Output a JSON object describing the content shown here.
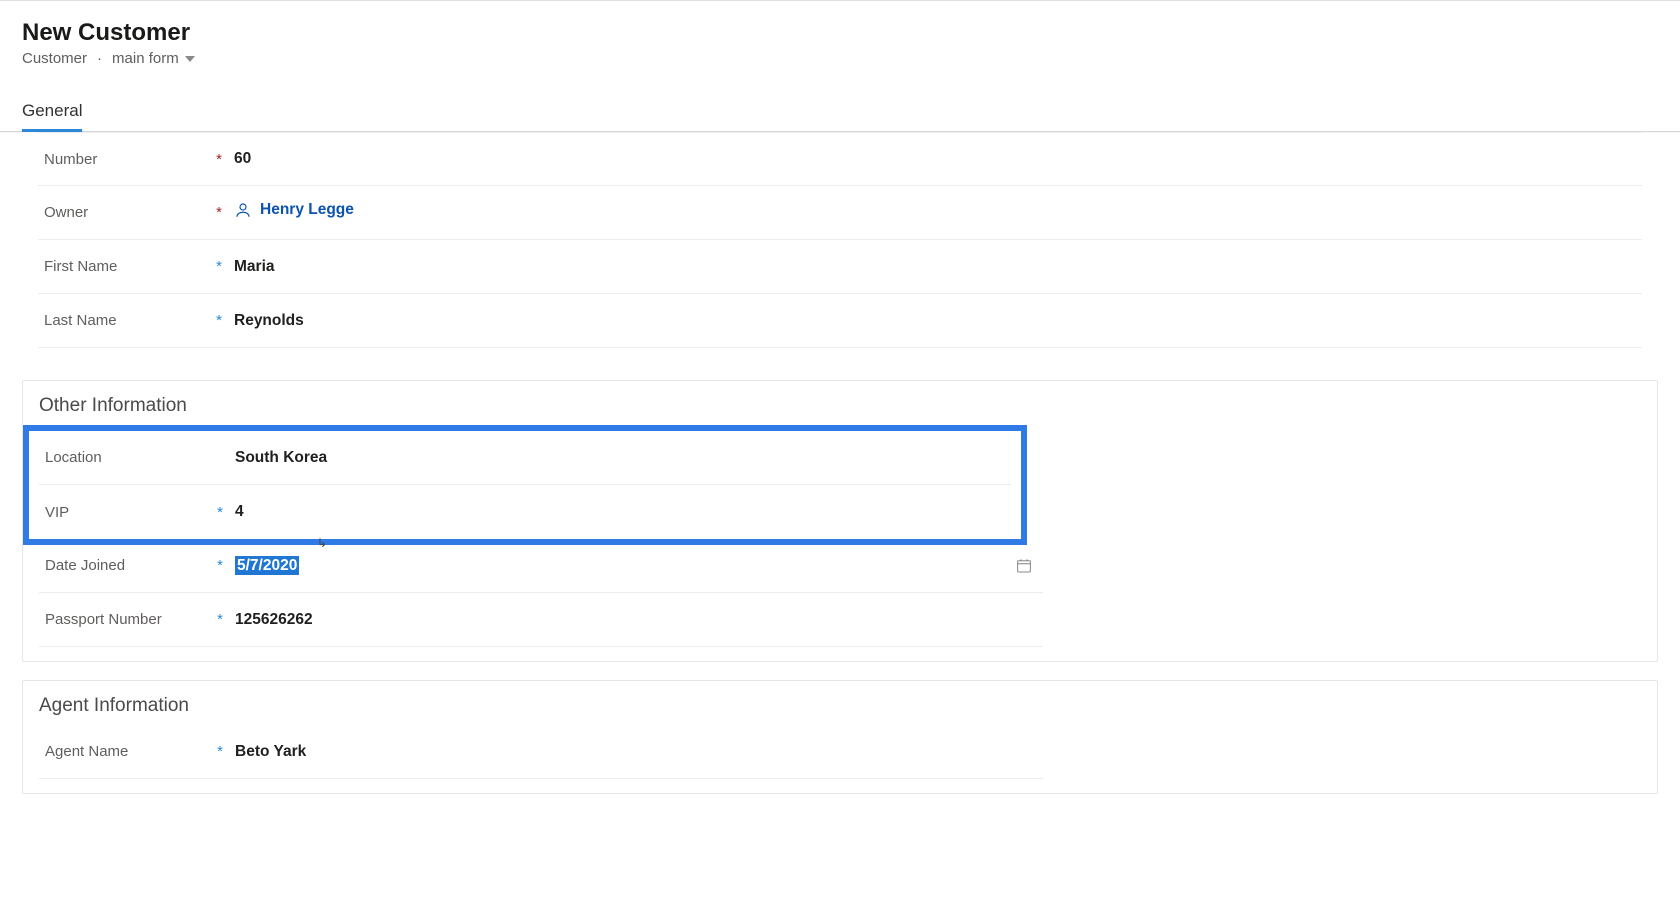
{
  "header": {
    "title": "New Customer",
    "entity": "Customer",
    "form_name": "main form"
  },
  "tabs": [
    {
      "label": "General",
      "active": true
    }
  ],
  "sections": {
    "basic": {
      "fields": {
        "number": {
          "label": "Number",
          "value": "60",
          "required": "red"
        },
        "owner": {
          "label": "Owner",
          "value": "Henry Legge",
          "required": "red"
        },
        "first_name": {
          "label": "First Name",
          "value": "Maria",
          "required": "blue"
        },
        "last_name": {
          "label": "Last Name",
          "value": "Reynolds",
          "required": "blue"
        }
      }
    },
    "other": {
      "title": "Other Information",
      "fields": {
        "location": {
          "label": "Location",
          "value": "South Korea",
          "required": ""
        },
        "vip": {
          "label": "VIP",
          "value": "4",
          "required": "blue"
        },
        "date_joined": {
          "label": "Date Joined",
          "value": "5/7/2020",
          "required": "blue"
        },
        "passport": {
          "label": "Passport Number",
          "value": "125626262",
          "required": "blue"
        }
      }
    },
    "agent": {
      "title": "Agent Information",
      "fields": {
        "agent_name": {
          "label": "Agent Name",
          "value": "Beto Yark",
          "required": "blue"
        }
      }
    }
  },
  "marker": {
    "required_red": "*",
    "required_blue": "*"
  },
  "colors": {
    "accent": "#2b88d8",
    "highlight_border": "#2f7ae5",
    "link": "#0b53b0"
  }
}
